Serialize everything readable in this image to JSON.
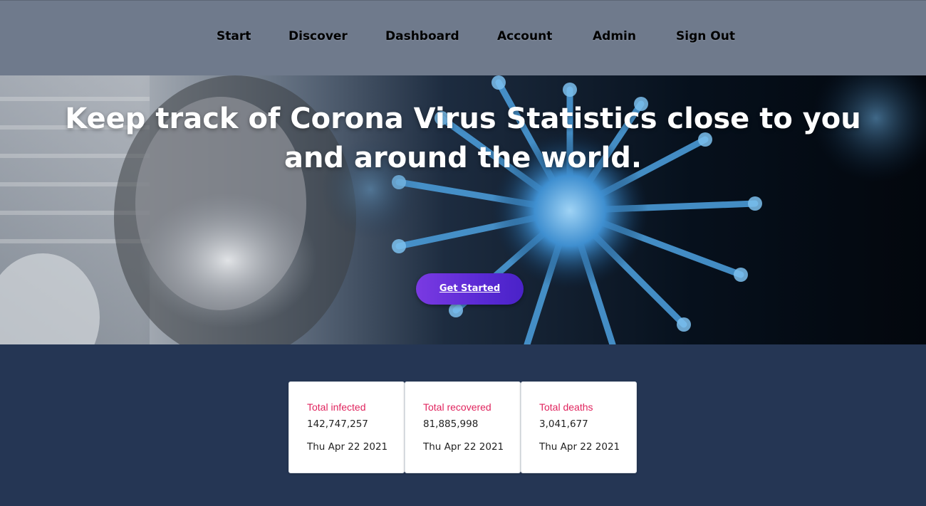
{
  "nav": {
    "items": [
      {
        "label": "Start"
      },
      {
        "label": "Discover"
      },
      {
        "label": "Dashboard"
      },
      {
        "label": "Account"
      },
      {
        "label": "Admin"
      },
      {
        "label": "Sign Out"
      }
    ]
  },
  "hero": {
    "title_line1": "Keep track of Corona Virus Statistics close to you",
    "title_line2": "and around the world.",
    "cta_label": "Get Started",
    "image": "masked-person-and-coronavirus-photo"
  },
  "stats": [
    {
      "label": "Total infected",
      "value": "142,747,257",
      "date": "Thu Apr 22 2021"
    },
    {
      "label": "Total recovered",
      "value": "81,885,998",
      "date": "Thu Apr 22 2021"
    },
    {
      "label": "Total deaths",
      "value": "3,041,677",
      "date": "Thu Apr 22 2021"
    }
  ],
  "colors": {
    "nav_bg": "#6f7a8c",
    "page_bg": "#253654",
    "stat_label": "#e0245e",
    "cta_start": "#7a3ae2",
    "cta_end": "#4a22c8"
  }
}
